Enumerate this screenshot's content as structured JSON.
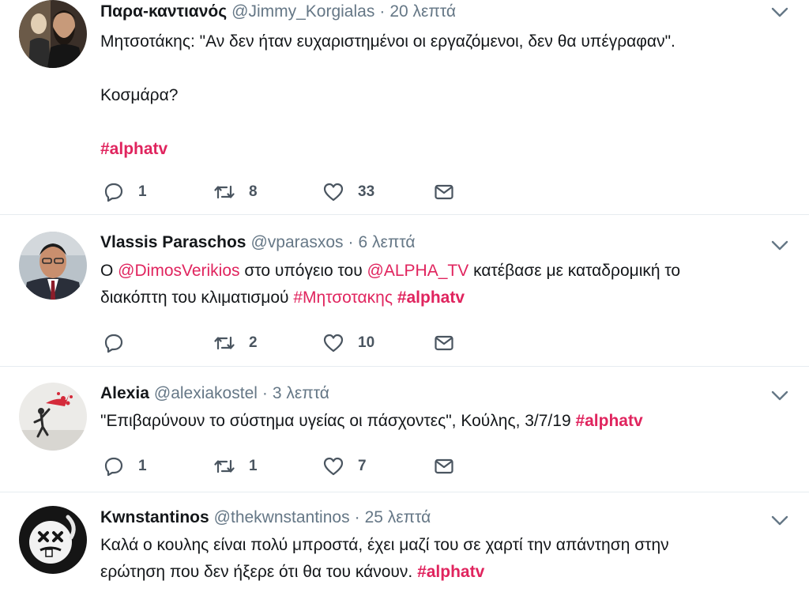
{
  "tweets": [
    {
      "name": "Παρα-καντιανός",
      "handle": "@Jimmy_Korgialas",
      "dot": "·",
      "time": "20 λεπτά",
      "line1": "Μητσοτάκης: \"Αν δεν ήταν ευχαριστημένοι οι εργαζόμενοι, δεν θα υπέγραφαν\".",
      "line2": "Κοσμάρα?",
      "hashtag": "#alphatv",
      "replies": "1",
      "retweets": "8",
      "likes": "33"
    },
    {
      "name": "Vlassis Paraschos",
      "handle": "@vparasxos",
      "dot": "·",
      "time": "6 λεπτά",
      "t1": "Ο ",
      "m1": "@DimosVerikios",
      "t2": " στο υπόγειο του ",
      "m2": "@ALPHA_TV",
      "t3": " κατέβασε με καταδρομική το",
      "t4": "διακόπτη του κλιματισμού ",
      "h1": "#Μητσοτακης",
      "t5": " ",
      "h2": "#alphatv",
      "replies": "",
      "retweets": "2",
      "likes": "10"
    },
    {
      "name": "Alexia",
      "handle": "@alexiakostel",
      "dot": "·",
      "time": "3 λεπτά",
      "t1": "\"Επιβαρύνουν το σύστημα υγείας οι πάσχοντες\", Κούλης, 3/7/19 ",
      "h1": "#alphatv",
      "replies": "1",
      "retweets": "1",
      "likes": "7"
    },
    {
      "name": "Kwnstantinos",
      "handle": "@thekwnstantinos",
      "dot": "·",
      "time": "25 λεπτά",
      "t1": "Καλά ο κουλης είναι πολύ μπροστά, έχει μαζί του σε χαρτί την απάντηση στην",
      "t2": "ερώτηση που δεν ήξερε ότι θα του κάνουν. ",
      "h1": "#alphatv"
    }
  ],
  "colors": {
    "accent": "#e0245e",
    "muted": "#657786",
    "text": "#14171a",
    "divider": "#e6ecf0"
  },
  "icons": [
    "reply-icon",
    "retweet-icon",
    "like-icon",
    "direct-message-icon",
    "chevron-down-icon"
  ]
}
